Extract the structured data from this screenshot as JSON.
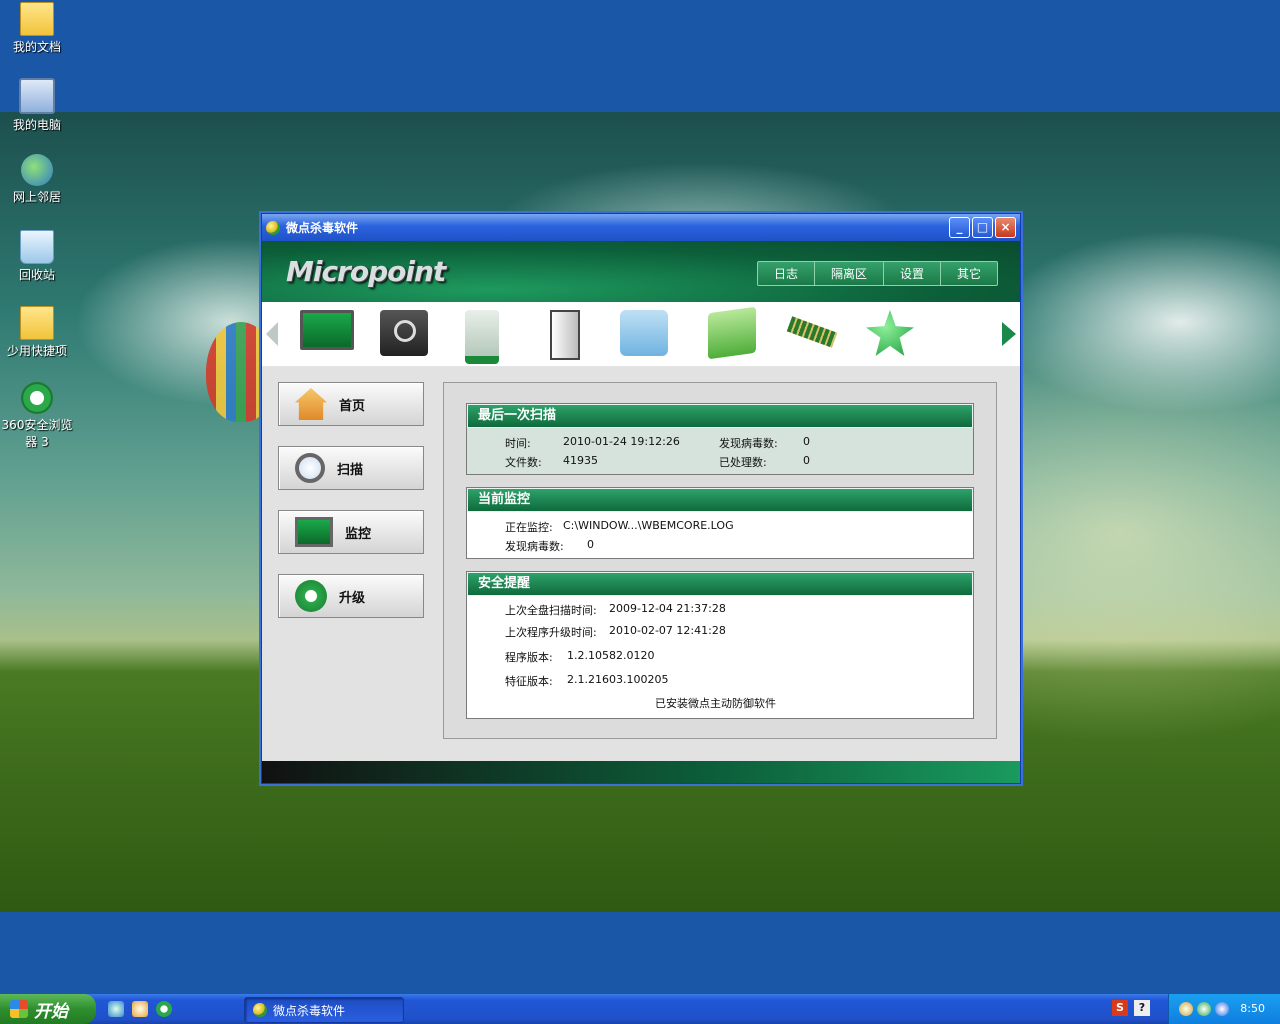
{
  "desktop": {
    "icons": [
      {
        "label": "我的文档"
      },
      {
        "label": "我的电脑"
      },
      {
        "label": "网上邻居"
      },
      {
        "label": "回收站"
      },
      {
        "label": "少用快捷项"
      },
      {
        "label": "360安全浏览器 3"
      }
    ]
  },
  "window": {
    "title": "微点杀毒软件",
    "brand": "Micropoint",
    "controls": {
      "minimize": "_",
      "maximize": "□",
      "close": "×"
    },
    "topnav": [
      "日志",
      "隔离区",
      "设置",
      "其它"
    ],
    "toolbar_icons": [
      "monitor-icon",
      "disk-scan-icon",
      "usb-drive-icon",
      "door-icon",
      "network-folder-icon",
      "green-folder-icon",
      "memory-icon",
      "star-icon"
    ],
    "sidebar": [
      {
        "label": "首页",
        "icon": "home-icon"
      },
      {
        "label": "扫描",
        "icon": "magnifier-icon"
      },
      {
        "label": "监控",
        "icon": "monitor-icon"
      },
      {
        "label": "升级",
        "icon": "refresh-icon"
      }
    ],
    "last_scan": {
      "title": "最后一次扫描",
      "time_label": "时间:",
      "time_value": "2010-01-24 19:12:26",
      "found_label": "发现病毒数:",
      "found_value": "0",
      "files_label": "文件数:",
      "files_value": "41935",
      "handled_label": "已处理数:",
      "handled_value": "0"
    },
    "monitor": {
      "title": "当前监控",
      "monitoring_label": "正在监控:",
      "monitoring_value": "C:\\WINDOW...\\WBEMCORE.LOG",
      "found_label": "发现病毒数:",
      "found_value": "0"
    },
    "security": {
      "title": "安全提醒",
      "last_full_scan_label": "上次全盘扫描时间:",
      "last_full_scan_value": "2009-12-04 21:37:28",
      "last_upgrade_label": "上次程序升级时间:",
      "last_upgrade_value": "2010-02-07 12:41:28",
      "program_version_label": "程序版本:",
      "program_version_value": "1.2.10582.0120",
      "signature_version_label": "特征版本:",
      "signature_version_value": "2.1.21603.100205",
      "note": "已安装微点主动防御软件"
    }
  },
  "taskbar": {
    "start_label": "开始",
    "task_label": "微点杀毒软件",
    "tray_ime_s": "S",
    "tray_help": "?",
    "clock": "8:50"
  }
}
